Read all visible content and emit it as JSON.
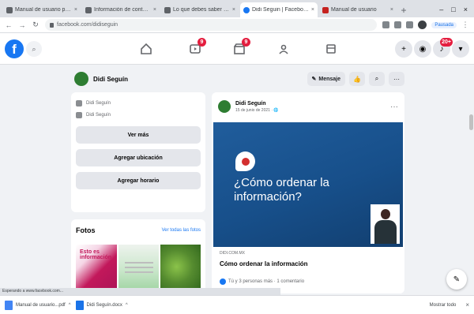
{
  "browser": {
    "tabs": [
      {
        "title": "Manual de usuario para el...",
        "active": false
      },
      {
        "title": "Información de contacto | ...",
        "active": false
      },
      {
        "title": "Lo que debes saber de...",
        "active": false
      },
      {
        "title": "Didi Seguin | Facebook",
        "active": true
      },
      {
        "title": "Manual de usuario",
        "active": false
      }
    ],
    "new_tab": "+",
    "url": "facebook.com/didiseguin",
    "sync_label": "Pausada",
    "window_controls": [
      "–",
      "□",
      "×"
    ]
  },
  "fbnav": {
    "logo": "f",
    "search_icon": "⌕",
    "badges": {
      "watch": "9",
      "marketplace": "9",
      "notifications": "20+"
    }
  },
  "page": {
    "name": "Didi Seguín",
    "message_button": "Mensaje",
    "like_icon": "👍",
    "search_icon": "⌕",
    "more_icon": "···"
  },
  "about": {
    "rows": [
      {
        "text": "Didi Seguín"
      },
      {
        "text": "Didi Seguín"
      }
    ],
    "buttons": [
      "Ver más",
      "Agregar ubicación",
      "Agregar horario"
    ]
  },
  "photos": {
    "title": "Fotos",
    "see_all": "Ver todas las fotos",
    "photo1_text": "Esto es información"
  },
  "post": {
    "author": "Didi Seguín",
    "date": "15 de junio de 2021 · 🌐",
    "more": "···",
    "image_title": "¿Cómo ordenar la información?",
    "domain": "DIDI.COM.MX",
    "caption": "Cómo ordenar la información",
    "reactions_text": "Tú y 3 personas más · 1 comentario"
  },
  "fab_icon": "✎",
  "statusbar": "Esperando a www.facebook.com...",
  "downloads": {
    "items": [
      {
        "name": "Manual de usuario...pdf"
      },
      {
        "name": "Didi Seguín.docx"
      }
    ],
    "show_all": "Mostrar todo",
    "close": "×"
  }
}
